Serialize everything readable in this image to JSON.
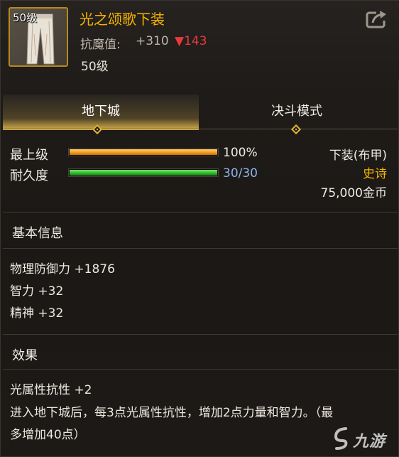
{
  "item": {
    "thumb_level": "50级",
    "name": "光之颂歌下装",
    "stat_label": "抗魔值:",
    "stat_value": "+310",
    "stat_diff": "▼143",
    "level": "50级"
  },
  "tabs": [
    {
      "label": "地下城",
      "active": true
    },
    {
      "label": "决斗模式",
      "active": false
    }
  ],
  "bars": [
    {
      "label": "最上级",
      "value": "100%",
      "fill": 1.0,
      "color": "#f5a623"
    },
    {
      "label": "耐久度",
      "value": "30/30",
      "fill": 1.0,
      "color": "#3fb83c"
    }
  ],
  "meta": {
    "slot": "下装(布甲)",
    "rarity": "史诗",
    "price": "75,000金币"
  },
  "basic": {
    "heading": "基本信息",
    "lines": [
      "物理防御力 +1876",
      "智力 +32",
      "精神 +32"
    ]
  },
  "effects": {
    "heading": "效果",
    "lines": [
      "光属性抗性 +2",
      "进入地下城后，每3点光属性抗性，增加2点力量和智力。（最",
      "多增加40点）"
    ]
  },
  "watermark": {
    "text": "九游",
    "icon": "jiuyou-logo-icon"
  },
  "colors": {
    "accent": "#f5b400",
    "rarity": "#f5b400",
    "down": "#e83a3a"
  }
}
